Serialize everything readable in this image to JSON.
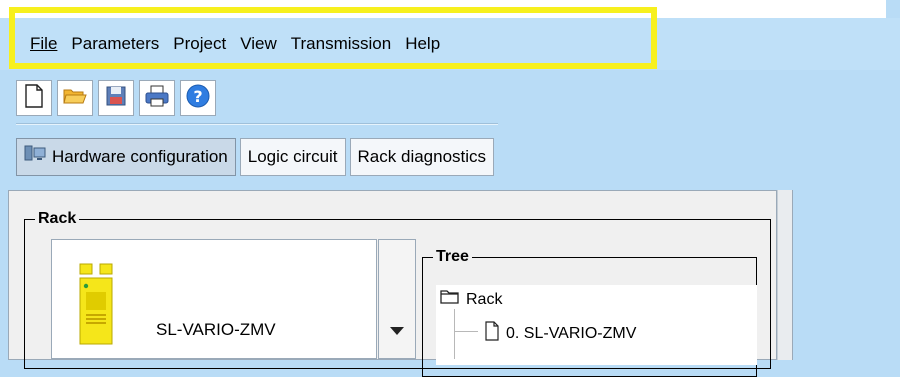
{
  "menubar": {
    "items": [
      {
        "label": "File"
      },
      {
        "label": "Parameters"
      },
      {
        "label": "Project"
      },
      {
        "label": "View"
      },
      {
        "label": "Transmission"
      },
      {
        "label": "Help"
      }
    ]
  },
  "toolbar": {
    "buttons": [
      {
        "icon": "new-document-icon"
      },
      {
        "icon": "open-folder-icon"
      },
      {
        "icon": "save-icon"
      },
      {
        "icon": "print-icon"
      },
      {
        "icon": "help-icon"
      }
    ]
  },
  "tabs": [
    {
      "label": "Hardware configuration",
      "active": true,
      "icon": "hardware-icon"
    },
    {
      "label": "Logic circuit",
      "active": false
    },
    {
      "label": "Rack diagnostics",
      "active": false
    }
  ],
  "rack": {
    "title": "Rack",
    "device_label": "SL-VARIO-ZMV"
  },
  "tree": {
    "title": "Tree",
    "root_label": "Rack",
    "child_label": "0. SL-VARIO-ZMV"
  },
  "colors": {
    "background": "#b9dcf6",
    "highlight": "#f7f01e",
    "device_yellow": "#f5e61a"
  }
}
